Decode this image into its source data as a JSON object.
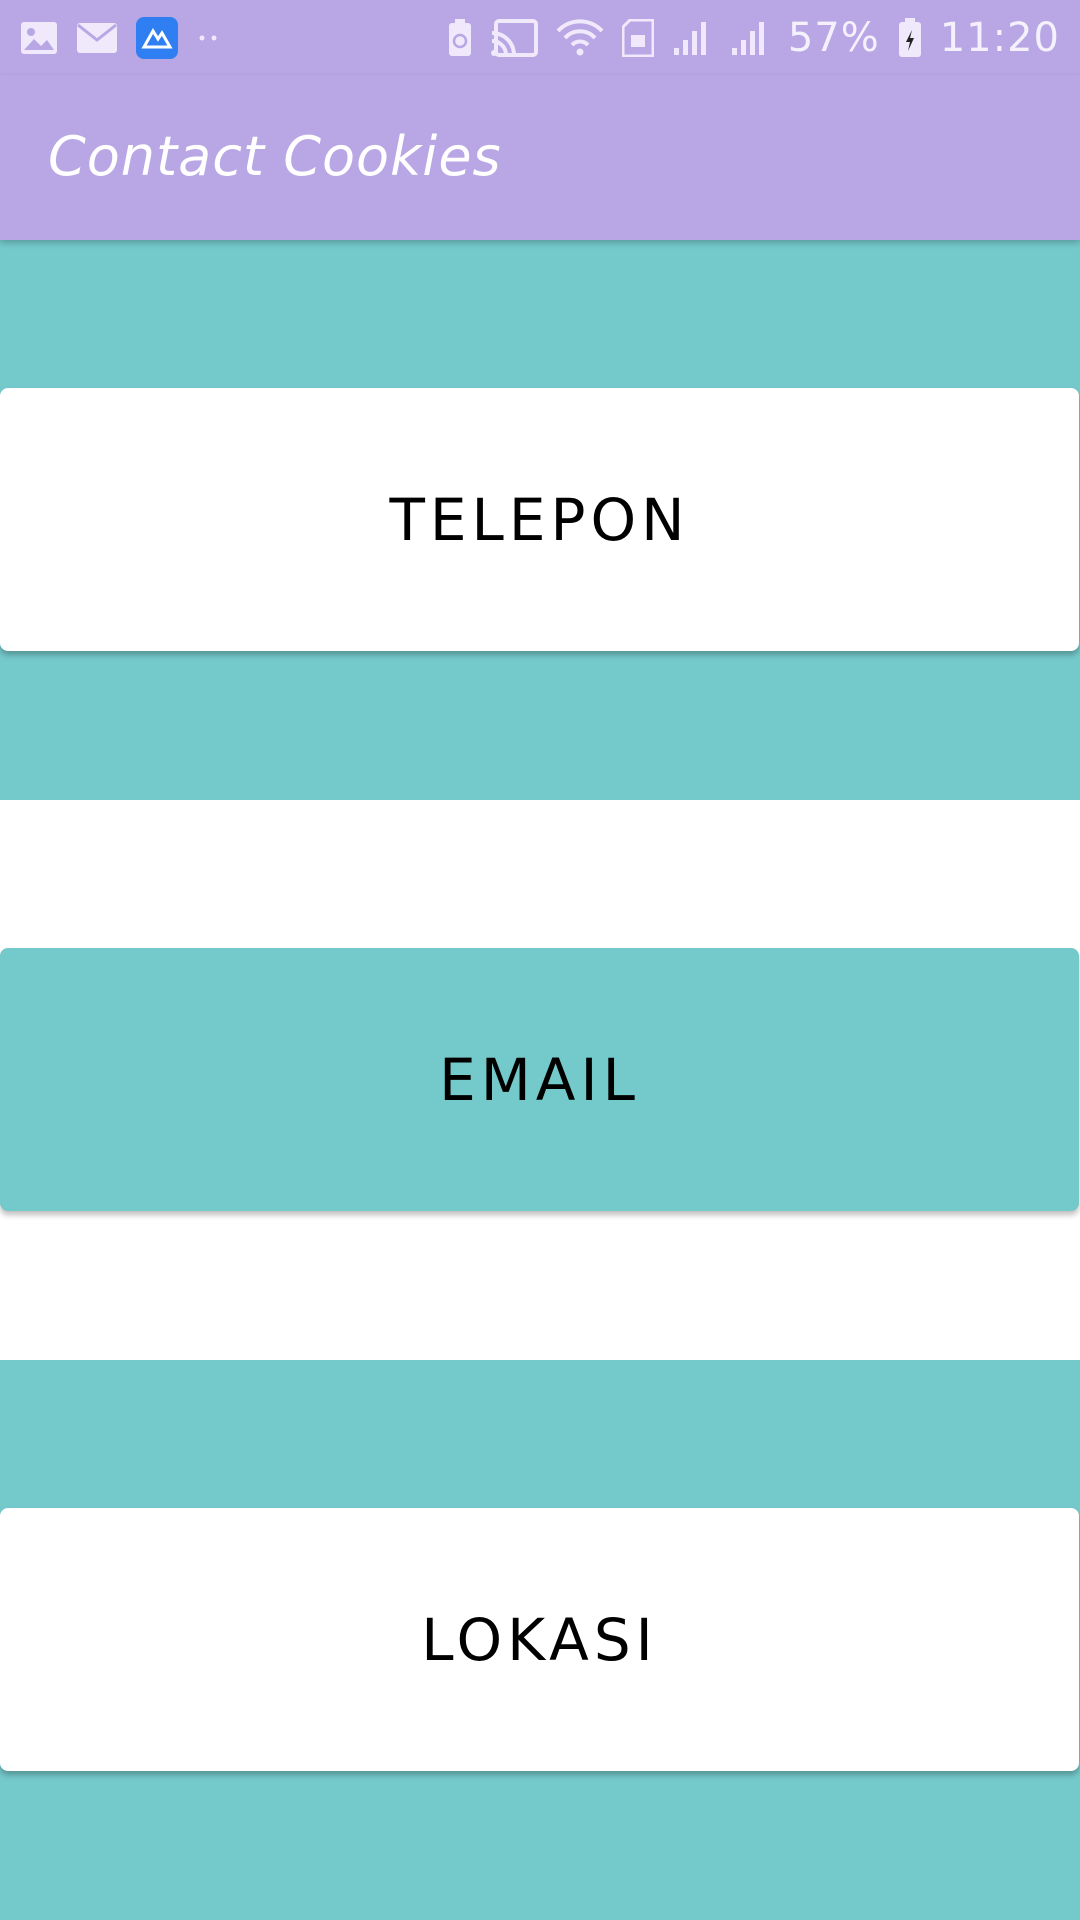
{
  "status_bar": {
    "left_icons": [
      "gallery-icon",
      "mail-icon",
      "app-icon",
      "more-dots-icon"
    ],
    "right_icons": [
      "battery-saver-icon",
      "cast-icon",
      "wifi-icon",
      "sim-icon",
      "signal-icon",
      "signal-icon"
    ],
    "battery_percent": "57%",
    "time": "11:20"
  },
  "app_bar": {
    "title": "Contact Cookies"
  },
  "buttons": {
    "telepon": "TELEPON",
    "email": "EMAIL",
    "lokasi": "LOKASI"
  },
  "colors": {
    "primary": "#b9a6e4",
    "accent_teal": "#74c9cb",
    "card_white": "#ffffff",
    "text": "#000000"
  }
}
